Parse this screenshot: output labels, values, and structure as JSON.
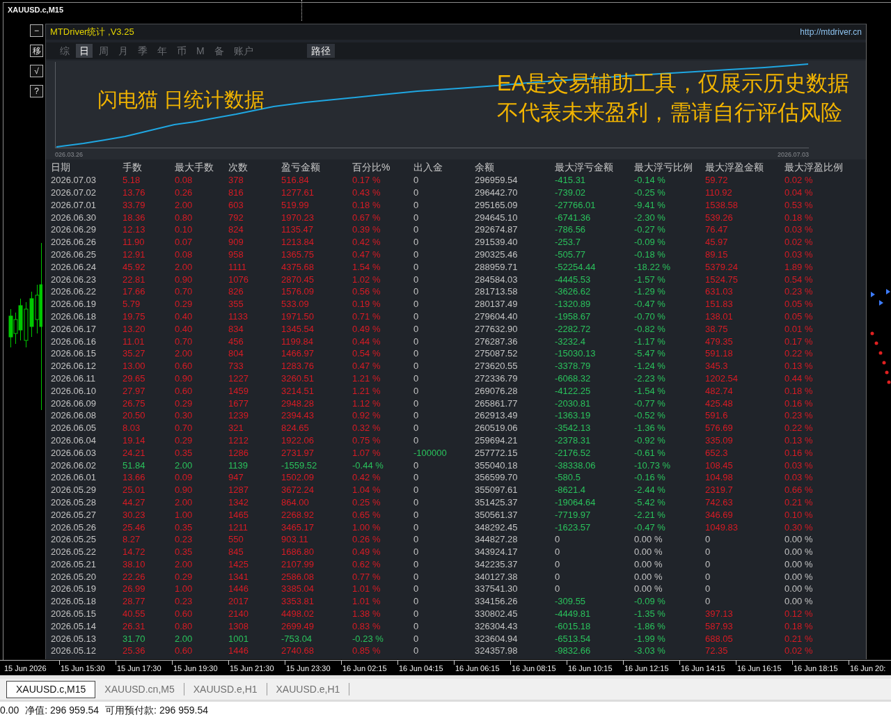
{
  "chart_window": {
    "title": "XAUUSD.c,M15"
  },
  "side_buttons": [
    "−",
    "移",
    "√",
    "?"
  ],
  "panel": {
    "title": "MTDriver统计 ,V3.25",
    "url": "http://mtdriver.cn",
    "tabs": [
      {
        "label": "综",
        "selected": false
      },
      {
        "label": "日",
        "selected": true
      },
      {
        "label": "周",
        "selected": false
      },
      {
        "label": "月",
        "selected": false
      },
      {
        "label": "季",
        "selected": false
      },
      {
        "label": "年",
        "selected": false
      },
      {
        "label": "币",
        "selected": false
      },
      {
        "label": "M",
        "selected": false
      },
      {
        "label": "备",
        "selected": false
      },
      {
        "label": "账户",
        "selected": false
      }
    ],
    "path_button": "路径",
    "chart": {
      "start_label": "026.03.26",
      "end_label": "2026.07.03"
    },
    "caption": "闪电猫 日统计数据",
    "disclaimer": [
      "EA是交易辅助工具，仅展示历史数据",
      "不代表未来盈利，需请自行评估风险"
    ]
  },
  "table": {
    "columns": [
      "日期",
      "手数",
      "最大手数",
      "次数",
      "盈亏金额",
      "百分比%",
      "出入金",
      "余额",
      "最大浮亏金额",
      "最大浮亏比例",
      "最大浮盈金额",
      "最大浮盈比例"
    ],
    "rows": [
      {
        "cells": [
          "2026.07.03",
          "5.18",
          "0.08",
          "378",
          "516.84",
          "0.17 %",
          "0",
          "296959.54",
          "-415.31",
          "-0.14 %",
          "59.72",
          "0.02 %"
        ],
        "loss": false,
        "cash_flow": false,
        "float_loss": true,
        "float_profit": true
      },
      {
        "cells": [
          "2026.07.02",
          "13.76",
          "0.26",
          "816",
          "1277.61",
          "0.43 %",
          "0",
          "296442.70",
          "-739.02",
          "-0.25 %",
          "110.92",
          "0.04 %"
        ],
        "loss": false,
        "cash_flow": false,
        "float_loss": true,
        "float_profit": true
      },
      {
        "cells": [
          "2026.07.01",
          "33.79",
          "2.00",
          "603",
          "519.99",
          "0.18 %",
          "0",
          "295165.09",
          "-27766.01",
          "-9.41 %",
          "1538.58",
          "0.53 %"
        ],
        "loss": false,
        "cash_flow": false,
        "float_loss": true,
        "float_profit": true
      },
      {
        "cells": [
          "2026.06.30",
          "18.36",
          "0.80",
          "792",
          "1970.23",
          "0.67 %",
          "0",
          "294645.10",
          "-6741.36",
          "-2.30 %",
          "539.26",
          "0.18 %"
        ],
        "loss": false,
        "cash_flow": false,
        "float_loss": true,
        "float_profit": true
      },
      {
        "cells": [
          "2026.06.29",
          "12.13",
          "0.10",
          "824",
          "1135.47",
          "0.39 %",
          "0",
          "292674.87",
          "-786.56",
          "-0.27 %",
          "76.47",
          "0.03 %"
        ],
        "loss": false,
        "cash_flow": false,
        "float_loss": true,
        "float_profit": true
      },
      {
        "cells": [
          "2026.06.26",
          "11.90",
          "0.07",
          "909",
          "1213.84",
          "0.42 %",
          "0",
          "291539.40",
          "-253.7",
          "-0.09 %",
          "45.97",
          "0.02 %"
        ],
        "loss": false,
        "cash_flow": false,
        "float_loss": true,
        "float_profit": true
      },
      {
        "cells": [
          "2026.06.25",
          "12.91",
          "0.08",
          "958",
          "1365.75",
          "0.47 %",
          "0",
          "290325.46",
          "-505.77",
          "-0.18 %",
          "89.15",
          "0.03 %"
        ],
        "loss": false,
        "cash_flow": false,
        "float_loss": true,
        "float_profit": true
      },
      {
        "cells": [
          "2026.06.24",
          "45.92",
          "2.00",
          "1111",
          "4375.68",
          "1.54 %",
          "0",
          "288959.71",
          "-52254.44",
          "-18.22 %",
          "5379.24",
          "1.89 %"
        ],
        "loss": false,
        "cash_flow": false,
        "float_loss": true,
        "float_profit": true
      },
      {
        "cells": [
          "2026.06.23",
          "22.81",
          "0.90",
          "1076",
          "2870.45",
          "1.02 %",
          "0",
          "284584.03",
          "-4445.53",
          "-1.57 %",
          "1524.75",
          "0.54 %"
        ],
        "loss": false,
        "cash_flow": false,
        "float_loss": true,
        "float_profit": true
      },
      {
        "cells": [
          "2026.06.22",
          "17.66",
          "0.70",
          "826",
          "1576.09",
          "0.56 %",
          "0",
          "281713.58",
          "-3626.62",
          "-1.29 %",
          "631.03",
          "0.23 %"
        ],
        "loss": false,
        "cash_flow": false,
        "float_loss": true,
        "float_profit": true
      },
      {
        "cells": [
          "2026.06.19",
          "5.79",
          "0.29",
          "355",
          "533.09",
          "0.19 %",
          "0",
          "280137.49",
          "-1320.89",
          "-0.47 %",
          "151.83",
          "0.05 %"
        ],
        "loss": false,
        "cash_flow": false,
        "float_loss": true,
        "float_profit": true
      },
      {
        "cells": [
          "2026.06.18",
          "19.75",
          "0.40",
          "1133",
          "1971.50",
          "0.71 %",
          "0",
          "279604.40",
          "-1958.67",
          "-0.70 %",
          "138.01",
          "0.05 %"
        ],
        "loss": false,
        "cash_flow": false,
        "float_loss": true,
        "float_profit": true
      },
      {
        "cells": [
          "2026.06.17",
          "13.20",
          "0.40",
          "834",
          "1345.54",
          "0.49 %",
          "0",
          "277632.90",
          "-2282.72",
          "-0.82 %",
          "38.75",
          "0.01 %"
        ],
        "loss": false,
        "cash_flow": false,
        "float_loss": true,
        "float_profit": true
      },
      {
        "cells": [
          "2026.06.16",
          "11.01",
          "0.70",
          "456",
          "1199.84",
          "0.44 %",
          "0",
          "276287.36",
          "-3232.4",
          "-1.17 %",
          "479.35",
          "0.17 %"
        ],
        "loss": false,
        "cash_flow": false,
        "float_loss": true,
        "float_profit": true
      },
      {
        "cells": [
          "2026.06.15",
          "35.27",
          "2.00",
          "804",
          "1466.97",
          "0.54 %",
          "0",
          "275087.52",
          "-15030.13",
          "-5.47 %",
          "591.18",
          "0.22 %"
        ],
        "loss": false,
        "cash_flow": false,
        "float_loss": true,
        "float_profit": true
      },
      {
        "cells": [
          "2026.06.12",
          "13.00",
          "0.60",
          "733",
          "1283.76",
          "0.47 %",
          "0",
          "273620.55",
          "-3378.79",
          "-1.24 %",
          "345.3",
          "0.13 %"
        ],
        "loss": false,
        "cash_flow": false,
        "float_loss": true,
        "float_profit": true
      },
      {
        "cells": [
          "2026.06.11",
          "29.65",
          "0.90",
          "1227",
          "3260.51",
          "1.21 %",
          "0",
          "272336.79",
          "-6068.32",
          "-2.23 %",
          "1202.54",
          "0.44 %"
        ],
        "loss": false,
        "cash_flow": false,
        "float_loss": true,
        "float_profit": true
      },
      {
        "cells": [
          "2026.06.10",
          "27.97",
          "0.60",
          "1459",
          "3214.51",
          "1.21 %",
          "0",
          "269076.28",
          "-4122.25",
          "-1.54 %",
          "482.74",
          "0.18 %"
        ],
        "loss": false,
        "cash_flow": false,
        "float_loss": true,
        "float_profit": true
      },
      {
        "cells": [
          "2026.06.09",
          "26.75",
          "0.29",
          "1677",
          "2948.28",
          "1.12 %",
          "0",
          "265861.77",
          "-2030.81",
          "-0.77 %",
          "425.48",
          "0.16 %"
        ],
        "loss": false,
        "cash_flow": false,
        "float_loss": true,
        "float_profit": true
      },
      {
        "cells": [
          "2026.06.08",
          "20.50",
          "0.30",
          "1239",
          "2394.43",
          "0.92 %",
          "0",
          "262913.49",
          "-1363.19",
          "-0.52 %",
          "591.6",
          "0.23 %"
        ],
        "loss": false,
        "cash_flow": false,
        "float_loss": true,
        "float_profit": true
      },
      {
        "cells": [
          "2026.06.05",
          "8.03",
          "0.70",
          "321",
          "824.65",
          "0.32 %",
          "0",
          "260519.06",
          "-3542.13",
          "-1.36 %",
          "576.69",
          "0.22 %"
        ],
        "loss": false,
        "cash_flow": false,
        "float_loss": true,
        "float_profit": true
      },
      {
        "cells": [
          "2026.06.04",
          "19.14",
          "0.29",
          "1212",
          "1922.06",
          "0.75 %",
          "0",
          "259694.21",
          "-2378.31",
          "-0.92 %",
          "335.09",
          "0.13 %"
        ],
        "loss": false,
        "cash_flow": false,
        "float_loss": true,
        "float_profit": true
      },
      {
        "cells": [
          "2026.06.03",
          "24.21",
          "0.35",
          "1286",
          "2731.97",
          "1.07 %",
          "-100000",
          "257772.15",
          "-2176.52",
          "-0.61 %",
          "652.3",
          "0.16 %"
        ],
        "loss": false,
        "cash_flow": true,
        "float_loss": true,
        "float_profit": true
      },
      {
        "cells": [
          "2026.06.02",
          "51.84",
          "2.00",
          "1139",
          "-1559.52",
          "-0.44 %",
          "0",
          "355040.18",
          "-38338.06",
          "-10.73 %",
          "108.45",
          "0.03 %"
        ],
        "loss": true,
        "cash_flow": false,
        "float_loss": true,
        "float_profit": true
      },
      {
        "cells": [
          "2026.06.01",
          "13.66",
          "0.09",
          "947",
          "1502.09",
          "0.42 %",
          "0",
          "356599.70",
          "-580.5",
          "-0.16 %",
          "104.98",
          "0.03 %"
        ],
        "loss": false,
        "cash_flow": false,
        "float_loss": true,
        "float_profit": true
      },
      {
        "cells": [
          "2026.05.29",
          "25.01",
          "0.90",
          "1287",
          "3672.24",
          "1.04 %",
          "0",
          "355097.61",
          "-8621.4",
          "-2.44 %",
          "2319.7",
          "0.66 %"
        ],
        "loss": false,
        "cash_flow": false,
        "float_loss": true,
        "float_profit": true
      },
      {
        "cells": [
          "2026.05.28",
          "44.27",
          "2.00",
          "1342",
          "864.00",
          "0.25 %",
          "0",
          "351425.37",
          "-19064.64",
          "-5.42 %",
          "742.63",
          "0.21 %"
        ],
        "loss": false,
        "cash_flow": false,
        "float_loss": true,
        "float_profit": true
      },
      {
        "cells": [
          "2026.05.27",
          "30.23",
          "1.00",
          "1465",
          "2268.92",
          "0.65 %",
          "0",
          "350561.37",
          "-7719.97",
          "-2.21 %",
          "346.69",
          "0.10 %"
        ],
        "loss": false,
        "cash_flow": false,
        "float_loss": true,
        "float_profit": true
      },
      {
        "cells": [
          "2026.05.26",
          "25.46",
          "0.35",
          "1211",
          "3465.17",
          "1.00 %",
          "0",
          "348292.45",
          "-1623.57",
          "-0.47 %",
          "1049.83",
          "0.30 %"
        ],
        "loss": false,
        "cash_flow": false,
        "float_loss": true,
        "float_profit": true
      },
      {
        "cells": [
          "2026.05.25",
          "8.27",
          "0.23",
          "550",
          "903.11",
          "0.26 %",
          "0",
          "344827.28",
          "0",
          "0.00 %",
          "0",
          "0.00 %"
        ],
        "loss": false,
        "cash_flow": false,
        "float_loss": false,
        "float_profit": false
      },
      {
        "cells": [
          "2026.05.22",
          "14.72",
          "0.35",
          "845",
          "1686.80",
          "0.49 %",
          "0",
          "343924.17",
          "0",
          "0.00 %",
          "0",
          "0.00 %"
        ],
        "loss": false,
        "cash_flow": false,
        "float_loss": false,
        "float_profit": false
      },
      {
        "cells": [
          "2026.05.21",
          "38.10",
          "2.00",
          "1425",
          "2107.99",
          "0.62 %",
          "0",
          "342235.37",
          "0",
          "0.00 %",
          "0",
          "0.00 %"
        ],
        "loss": false,
        "cash_flow": false,
        "float_loss": false,
        "float_profit": false
      },
      {
        "cells": [
          "2026.05.20",
          "22.26",
          "0.29",
          "1341",
          "2586.08",
          "0.77 %",
          "0",
          "340127.38",
          "0",
          "0.00 %",
          "0",
          "0.00 %"
        ],
        "loss": false,
        "cash_flow": false,
        "float_loss": false,
        "float_profit": false
      },
      {
        "cells": [
          "2026.05.19",
          "26.99",
          "1.00",
          "1446",
          "3385.04",
          "1.01 %",
          "0",
          "337541.30",
          "0",
          "0.00 %",
          "0",
          "0.00 %"
        ],
        "loss": false,
        "cash_flow": false,
        "float_loss": false,
        "float_profit": false
      },
      {
        "cells": [
          "2026.05.18",
          "28.77",
          "0.23",
          "2017",
          "3353.81",
          "1.01 %",
          "0",
          "334156.26",
          "-309.55",
          "-0.09 %",
          "0",
          "0.00 %"
        ],
        "loss": false,
        "cash_flow": false,
        "float_loss": true,
        "float_profit": false
      },
      {
        "cells": [
          "2026.05.15",
          "40.55",
          "0.60",
          "2140",
          "4498.02",
          "1.38 %",
          "0",
          "330802.45",
          "-4449.81",
          "-1.35 %",
          "397.13",
          "0.12 %"
        ],
        "loss": false,
        "cash_flow": false,
        "float_loss": true,
        "float_profit": true
      },
      {
        "cells": [
          "2026.05.14",
          "26.31",
          "0.80",
          "1308",
          "2699.49",
          "0.83 %",
          "0",
          "326304.43",
          "-6015.18",
          "-1.86 %",
          "587.93",
          "0.18 %"
        ],
        "loss": false,
        "cash_flow": false,
        "float_loss": true,
        "float_profit": true
      },
      {
        "cells": [
          "2026.05.13",
          "31.70",
          "2.00",
          "1001",
          "-753.04",
          "-0.23 %",
          "0",
          "323604.94",
          "-6513.54",
          "-1.99 %",
          "688.05",
          "0.21 %"
        ],
        "loss": true,
        "cash_flow": false,
        "float_loss": true,
        "float_profit": true
      },
      {
        "cells": [
          "2026.05.12",
          "25.36",
          "0.60",
          "1446",
          "2740.68",
          "0.85 %",
          "0",
          "324357.98",
          "-9832.66",
          "-3.03 %",
          "72.35",
          "0.02 %"
        ],
        "loss": false,
        "cash_flow": false,
        "float_loss": true,
        "float_profit": true
      }
    ]
  },
  "time_axis": [
    "15 Jun 2026",
    "15 Jun 15:30",
    "15 Jun 17:30",
    "15 Jun 19:30",
    "15 Jun 21:30",
    "15 Jun 23:30",
    "16 Jun 02:15",
    "16 Jun 04:15",
    "16 Jun 06:15",
    "16 Jun 08:15",
    "16 Jun 10:15",
    "16 Jun 12:15",
    "16 Jun 14:15",
    "16 Jun 16:15",
    "16 Jun 18:15",
    "16 Jun 20:"
  ],
  "symbol_tabs": [
    {
      "label": "XAUUSD.c,M15",
      "selected": true
    },
    {
      "label": "XAUUSD.cn,M5",
      "selected": false
    },
    {
      "label": "XAUUSD.e,H1",
      "selected": false
    },
    {
      "label": "XAUUSD.e,H1",
      "selected": false
    }
  ],
  "status_bar": [
    "0.00",
    "净值: 296 959.54",
    "可用预付款: 296 959.54"
  ]
}
